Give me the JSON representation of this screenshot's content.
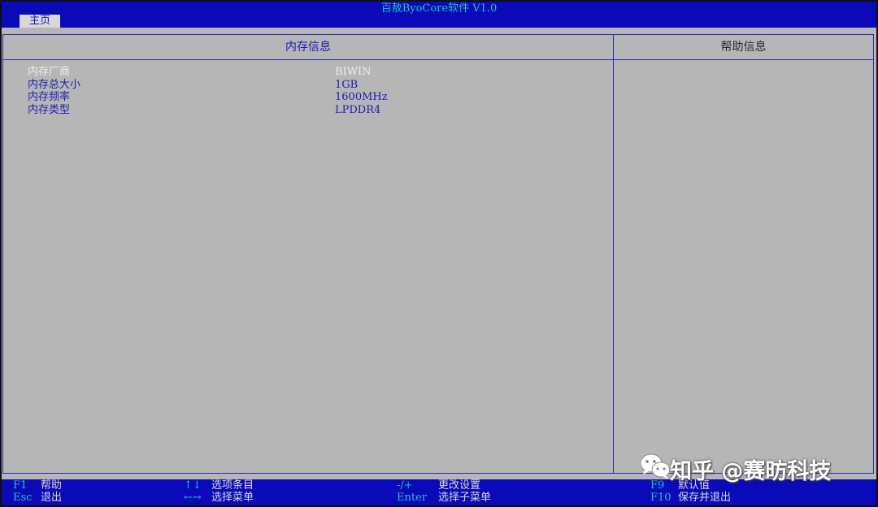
{
  "header": {
    "app_title": "百敖ByoCore软件 V1.0",
    "tab_main": "主页"
  },
  "memory_panel": {
    "title": "内存信息",
    "rows": [
      {
        "label": "内存厂商",
        "value": "BIWIN"
      },
      {
        "label": "内存总大小",
        "value": "1GB"
      },
      {
        "label": "内存频率",
        "value": "1600MHz"
      },
      {
        "label": "内存类型",
        "value": "LPDDR4"
      }
    ]
  },
  "help_panel": {
    "title": "帮助信息"
  },
  "footer": {
    "keys": [
      {
        "key": "F1",
        "desc": "帮助"
      },
      {
        "key": "Esc",
        "desc": "退出"
      },
      {
        "key": "↑↓",
        "desc": "选项条目"
      },
      {
        "key": "←→",
        "desc": "选择菜单"
      },
      {
        "key": "-/+",
        "desc": "更改设置"
      },
      {
        "key": "Enter",
        "desc": "选择子菜单"
      },
      {
        "key": "F9",
        "desc": "默认值"
      },
      {
        "key": "F10",
        "desc": "保存并退出"
      }
    ]
  },
  "watermark": {
    "text": "知乎 @赛昉科技",
    "icon": "wechat-icon"
  },
  "colors": {
    "bar_blue": "#0a0ab8",
    "panel_gray": "#b6b6b6",
    "text_blue": "#1c1cb2",
    "key_cyan": "#1ec2c2",
    "highlight_white": "#eeeeee"
  }
}
